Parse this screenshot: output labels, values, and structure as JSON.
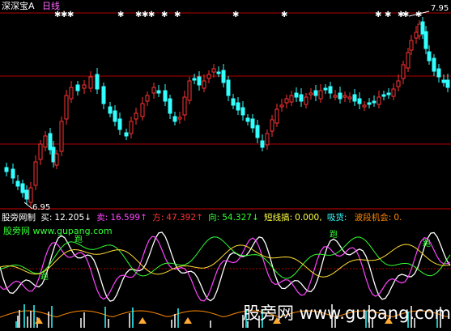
{
  "header": {
    "app_title": "深深宝A",
    "period": "日线"
  },
  "indicator": {
    "name": "股旁网制",
    "buy_label": "买:",
    "buy_value": "12.205↓",
    "sell_label": "卖:",
    "sell_value": "16.599↑",
    "side_label": "方:",
    "side_value": "47.392↑",
    "dir_label": "向:",
    "dir_value": "54.327↓",
    "short_label": "短线搞:",
    "short_value": "0.000,",
    "absorb_label": "吸货:",
    "absorb_value": "",
    "wave_label": "波段机会:",
    "wave_value": "0."
  },
  "price_labels": {
    "high": "7.95",
    "low": "6.95"
  },
  "watermarks": {
    "site_small": "股旁网 www.gupang.com",
    "run_label_1": "跑",
    "run_label_2": "跑",
    "run_label_3": "跑",
    "run_label_4": "跑",
    "site_large": "股旁网 www.gupang.com"
  },
  "colors": {
    "up": "#ff3333",
    "down": "#33ffff",
    "grid": "#b00000",
    "white_line": "#ffffff",
    "magenta_line": "#ff44ff",
    "green_line": "#33ff33",
    "orange": "#ff8800"
  },
  "chart_data": {
    "type": "candlestick",
    "price_high_label": 7.95,
    "price_low_label": 6.95,
    "candle_count": 96
  }
}
